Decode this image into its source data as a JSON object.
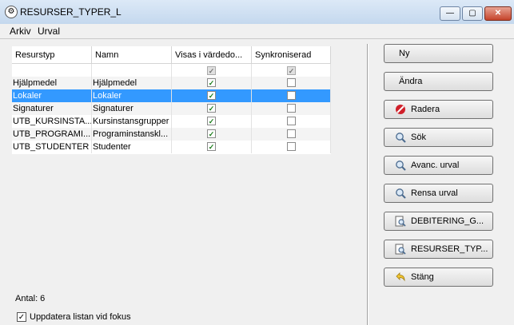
{
  "window": {
    "title": "RESURSER_TYPER_L"
  },
  "menu": [
    {
      "label": "Arkiv"
    },
    {
      "label": "Urval"
    }
  ],
  "table": {
    "columns": [
      "Resurstyp",
      "Namn",
      "Visas i värdedo...",
      "Synkroniserad"
    ],
    "rows": [
      {
        "resurstyp": "Hjälpmedel",
        "namn": "Hjälpmedel",
        "visas": true,
        "synk": false
      },
      {
        "resurstyp": "Lokaler",
        "namn": "Lokaler",
        "visas": true,
        "synk": false,
        "selected": true
      },
      {
        "resurstyp": "Signaturer",
        "namn": "Signaturer",
        "visas": true,
        "synk": false
      },
      {
        "resurstyp": "UTB_KURSINSTA...",
        "namn": "Kursinstansgrupper",
        "visas": true,
        "synk": false
      },
      {
        "resurstyp": "UTB_PROGRAMI...",
        "namn": "Programinstanskl...",
        "visas": true,
        "synk": false
      },
      {
        "resurstyp": "UTB_STUDENTER",
        "namn": "Studenter",
        "visas": true,
        "synk": false
      }
    ]
  },
  "buttons": [
    {
      "label": "Ny",
      "icon": ""
    },
    {
      "label": "Ändra",
      "icon": ""
    },
    {
      "label": "Radera",
      "icon": "delete-icon"
    },
    {
      "label": "Sök",
      "icon": "magnifier-icon"
    },
    {
      "label": "Avanc. urval",
      "icon": "magnifier-icon"
    },
    {
      "label": "Rensa urval",
      "icon": "magnifier-icon"
    },
    {
      "label": "DEBITERING_G...",
      "icon": "report-search-icon"
    },
    {
      "label": "RESURSER_TYP...",
      "icon": "report-search-icon"
    },
    {
      "label": "Stäng",
      "icon": "back-arrow-icon"
    }
  ],
  "footer": {
    "count_label": "Antal: 6",
    "refresh_label": "Uppdatera listan vid fokus",
    "refresh_checked": true
  },
  "colors": {
    "selection": "#3399ff",
    "check": "#1a7d1a",
    "delete": "#d0202a"
  }
}
